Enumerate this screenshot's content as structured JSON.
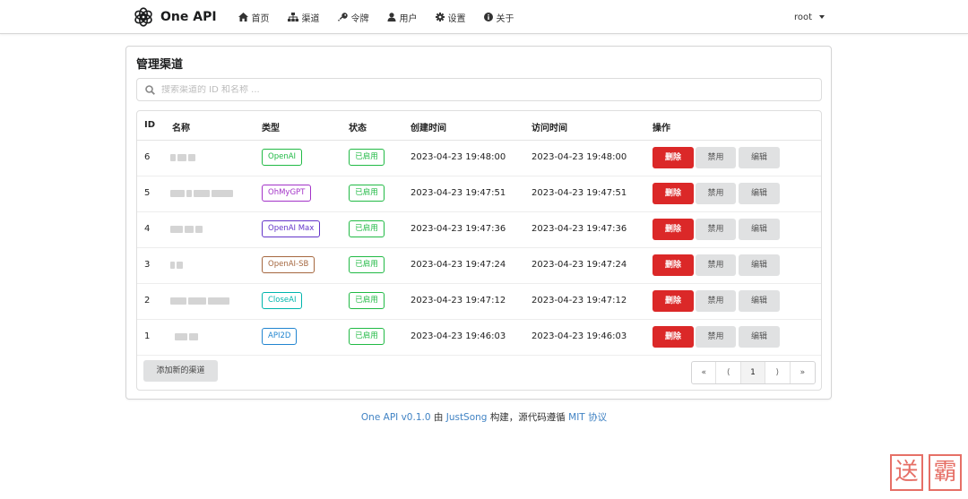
{
  "nav": {
    "brand": "One API",
    "items": [
      {
        "label": "首页",
        "icon": "home-icon"
      },
      {
        "label": "渠道",
        "icon": "sitemap-icon"
      },
      {
        "label": "令牌",
        "icon": "key-icon"
      },
      {
        "label": "用户",
        "icon": "user-icon"
      },
      {
        "label": "设置",
        "icon": "gear-icon"
      },
      {
        "label": "关于",
        "icon": "info-icon"
      }
    ],
    "user": "root"
  },
  "page": {
    "title": "管理渠道",
    "search_placeholder": "搜索渠道的 ID 和名称 ..."
  },
  "table": {
    "headers": [
      "ID",
      "名称",
      "类型",
      "状态",
      "创建时间",
      "访问时间",
      "操作"
    ],
    "rows": [
      {
        "id": "6",
        "type": "OpenAI",
        "type_color": "#21ba45",
        "status": "已启用",
        "created": "2023-04-23 19:48:00",
        "accessed": "2023-04-23 19:48:00"
      },
      {
        "id": "5",
        "type": "OhMyGPT",
        "type_color": "#a333c8",
        "status": "已启用",
        "created": "2023-04-23 19:47:51",
        "accessed": "2023-04-23 19:47:51"
      },
      {
        "id": "4",
        "type": "OpenAI Max",
        "type_color": "#6435c9",
        "status": "已启用",
        "created": "2023-04-23 19:47:36",
        "accessed": "2023-04-23 19:47:36"
      },
      {
        "id": "3",
        "type": "OpenAI-SB",
        "type_color": "#a5673f",
        "status": "已启用",
        "created": "2023-04-23 19:47:24",
        "accessed": "2023-04-23 19:47:24"
      },
      {
        "id": "2",
        "type": "CloseAI",
        "type_color": "#00b5ad",
        "status": "已启用",
        "created": "2023-04-23 19:47:12",
        "accessed": "2023-04-23 19:47:12"
      },
      {
        "id": "1",
        "type": "API2D",
        "type_color": "#2185d0",
        "status": "已启用",
        "created": "2023-04-23 19:46:03",
        "accessed": "2023-04-23 19:46:03"
      }
    ],
    "actions": {
      "delete": "删除",
      "disable": "禁用",
      "edit": "编辑"
    }
  },
  "footer_bar": {
    "add_label": "添加新的渠道",
    "pagination": [
      "«",
      "⟨",
      "1",
      "⟩",
      "»"
    ],
    "current_page": "1"
  },
  "footer": {
    "version": "One API v0.1.0",
    "by": "由",
    "author": "JustSong",
    "mid": "构建，源代码遵循",
    "license": "MIT 协议"
  },
  "watermark": [
    "送",
    "霸"
  ],
  "colors": {
    "danger": "#db2828",
    "success": "#21ba45",
    "link": "#4183c4"
  }
}
